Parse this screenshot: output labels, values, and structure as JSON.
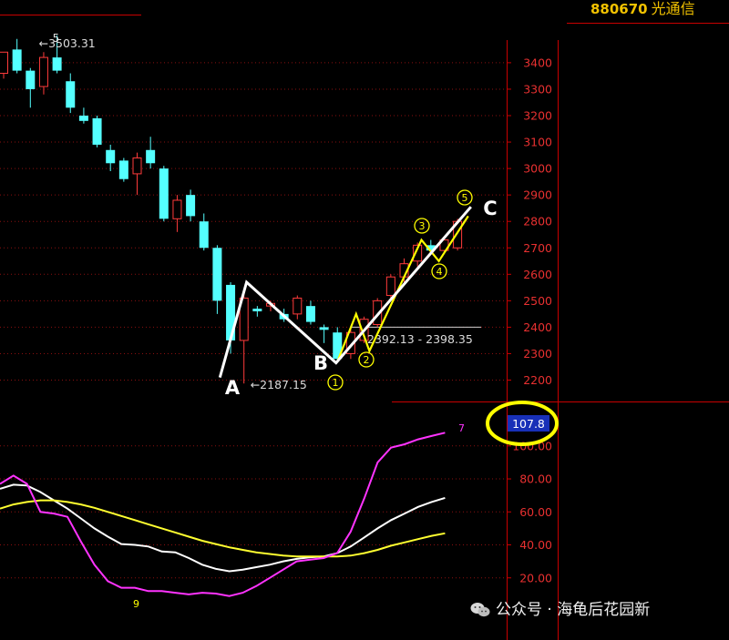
{
  "header": {
    "code": "880670",
    "name": "光通信"
  },
  "watermark": {
    "text": "公众号 · 海龟后花园新"
  },
  "colors": {
    "up": "#ff3b3b",
    "down": "#54ffff",
    "axis": "#c80000",
    "grid": "#8a1010",
    "wave_main": "#ffffff",
    "wave_sub": "#ffff00",
    "k_line": "#ffffff",
    "d_line": "#ffff30",
    "j_line": "#ff33ff",
    "highlight": "#ffff00"
  },
  "chart_data": [
    {
      "type": "candlestick",
      "title": "",
      "price_axis": {
        "ticks": [
          3400,
          3300,
          3200,
          3100,
          3000,
          2900,
          2800,
          2700,
          2600,
          2500,
          2400,
          2300,
          2200
        ],
        "ylim": [
          2150,
          3530
        ]
      },
      "candles": [
        {
          "open": 3360,
          "high": 3400,
          "low": 3340,
          "close": 3440
        },
        {
          "open": 3450,
          "high": 3490,
          "low": 3360,
          "close": 3370
        },
        {
          "open": 3370,
          "high": 3380,
          "low": 3230,
          "close": 3300
        },
        {
          "open": 3310,
          "high": 3440,
          "low": 3280,
          "close": 3420
        },
        {
          "open": 3420,
          "high": 3503.31,
          "low": 3360,
          "close": 3370
        },
        {
          "open": 3330,
          "high": 3360,
          "low": 3210,
          "close": 3230
        },
        {
          "open": 3200,
          "high": 3230,
          "low": 3170,
          "close": 3180
        },
        {
          "open": 3190,
          "high": 3200,
          "low": 3080,
          "close": 3090
        },
        {
          "open": 3070,
          "high": 3090,
          "low": 2990,
          "close": 3020
        },
        {
          "open": 3030,
          "high": 3040,
          "low": 2950,
          "close": 2960
        },
        {
          "open": 2980,
          "high": 3060,
          "low": 2900,
          "close": 3040
        },
        {
          "open": 3070,
          "high": 3120,
          "low": 3000,
          "close": 3020
        },
        {
          "open": 3000,
          "high": 3010,
          "low": 2800,
          "close": 2810
        },
        {
          "open": 2810,
          "high": 2900,
          "low": 2760,
          "close": 2880
        },
        {
          "open": 2900,
          "high": 2920,
          "low": 2800,
          "close": 2820
        },
        {
          "open": 2800,
          "high": 2830,
          "low": 2690,
          "close": 2700
        },
        {
          "open": 2700,
          "high": 2710,
          "low": 2450,
          "close": 2500
        },
        {
          "open": 2560,
          "high": 2570,
          "low": 2300,
          "close": 2350
        },
        {
          "open": 2350,
          "high": 2530,
          "low": 2187.15,
          "close": 2510
        },
        {
          "open": 2470,
          "high": 2480,
          "low": 2440,
          "close": 2460
        },
        {
          "open": 2480,
          "high": 2500,
          "low": 2460,
          "close": 2490
        },
        {
          "open": 2450,
          "high": 2470,
          "low": 2420,
          "close": 2430
        },
        {
          "open": 2450,
          "high": 2520,
          "low": 2430,
          "close": 2510
        },
        {
          "open": 2480,
          "high": 2500,
          "low": 2410,
          "close": 2420
        },
        {
          "open": 2400,
          "high": 2410,
          "low": 2340,
          "close": 2390
        },
        {
          "open": 2380,
          "high": 2400,
          "low": 2270,
          "close": 2280
        },
        {
          "open": 2300,
          "high": 2400,
          "low": 2280,
          "close": 2380
        },
        {
          "open": 2350,
          "high": 2440,
          "low": 2340,
          "close": 2430
        },
        {
          "open": 2410,
          "high": 2510,
          "low": 2400,
          "close": 2500
        },
        {
          "open": 2520,
          "high": 2600,
          "low": 2500,
          "close": 2590
        },
        {
          "open": 2590,
          "high": 2660,
          "low": 2570,
          "close": 2640
        },
        {
          "open": 2650,
          "high": 2720,
          "low": 2630,
          "close": 2710
        },
        {
          "open": 2710,
          "high": 2730,
          "low": 2680,
          "close": 2690
        },
        {
          "open": 2690,
          "high": 2740,
          "low": 2680,
          "close": 2730
        },
        {
          "open": 2700,
          "high": 2810,
          "low": 2690,
          "close": 2800
        }
      ],
      "annotations": {
        "high_label": "3503.31",
        "low_label": "2187.15",
        "gap_label": "2392.13 - 2398.35",
        "reference_level": 2400,
        "high_marker": "5",
        "letters": [
          "A",
          "B",
          "C"
        ],
        "wave_marks": [
          "1",
          "2",
          "3",
          "4",
          "5"
        ]
      },
      "main_wave": [
        {
          "bar": 16.2,
          "price": 2210
        },
        {
          "bar": 18.2,
          "price": 2570
        },
        {
          "bar": 24.9,
          "price": 2265
        },
        {
          "bar": 35.0,
          "price": 2855
        }
      ],
      "sub_wave": [
        {
          "bar": 25.0,
          "price": 2270
        },
        {
          "bar": 26.4,
          "price": 2450
        },
        {
          "bar": 27.4,
          "price": 2310
        },
        {
          "bar": 31.3,
          "price": 2730
        },
        {
          "bar": 32.6,
          "price": 2650
        },
        {
          "bar": 34.8,
          "price": 2820
        }
      ]
    },
    {
      "type": "line",
      "title": "",
      "indicator_axis": {
        "ticks": [
          100.0,
          80.0,
          60.0,
          40.0,
          20.0
        ],
        "ylim": [
          9,
          108
        ]
      },
      "current_value": "107.8",
      "j_high_marker": "7",
      "j_low_marker": "9",
      "series": [
        {
          "key": "k",
          "values": [
            74,
            76.5,
            76,
            72,
            67,
            62,
            56,
            50,
            45,
            40.5,
            40,
            39,
            36,
            35.5,
            32,
            28,
            25.5,
            24,
            25,
            26.5,
            28,
            30,
            31.5,
            32.5,
            33,
            35,
            39,
            44.5,
            50,
            55,
            59,
            63,
            66,
            68.5
          ]
        },
        {
          "key": "d",
          "values": [
            62,
            64.5,
            66,
            67,
            67,
            66,
            64.5,
            62.5,
            60,
            57.5,
            55,
            52.5,
            50,
            47.5,
            45,
            42.5,
            40.5,
            38.5,
            37,
            35.5,
            34.5,
            33.5,
            33,
            33,
            33,
            33,
            33.5,
            35,
            37,
            39.5,
            41.5,
            43.5,
            45.5,
            47
          ]
        },
        {
          "key": "j",
          "values": [
            77,
            82,
            77,
            60,
            59,
            57,
            42,
            28,
            18,
            14,
            14,
            12,
            12,
            11,
            10,
            11,
            10.5,
            9,
            11,
            15,
            20,
            25,
            30,
            31,
            32,
            35,
            48,
            68,
            90,
            99,
            101,
            104,
            106,
            108
          ]
        }
      ]
    }
  ]
}
